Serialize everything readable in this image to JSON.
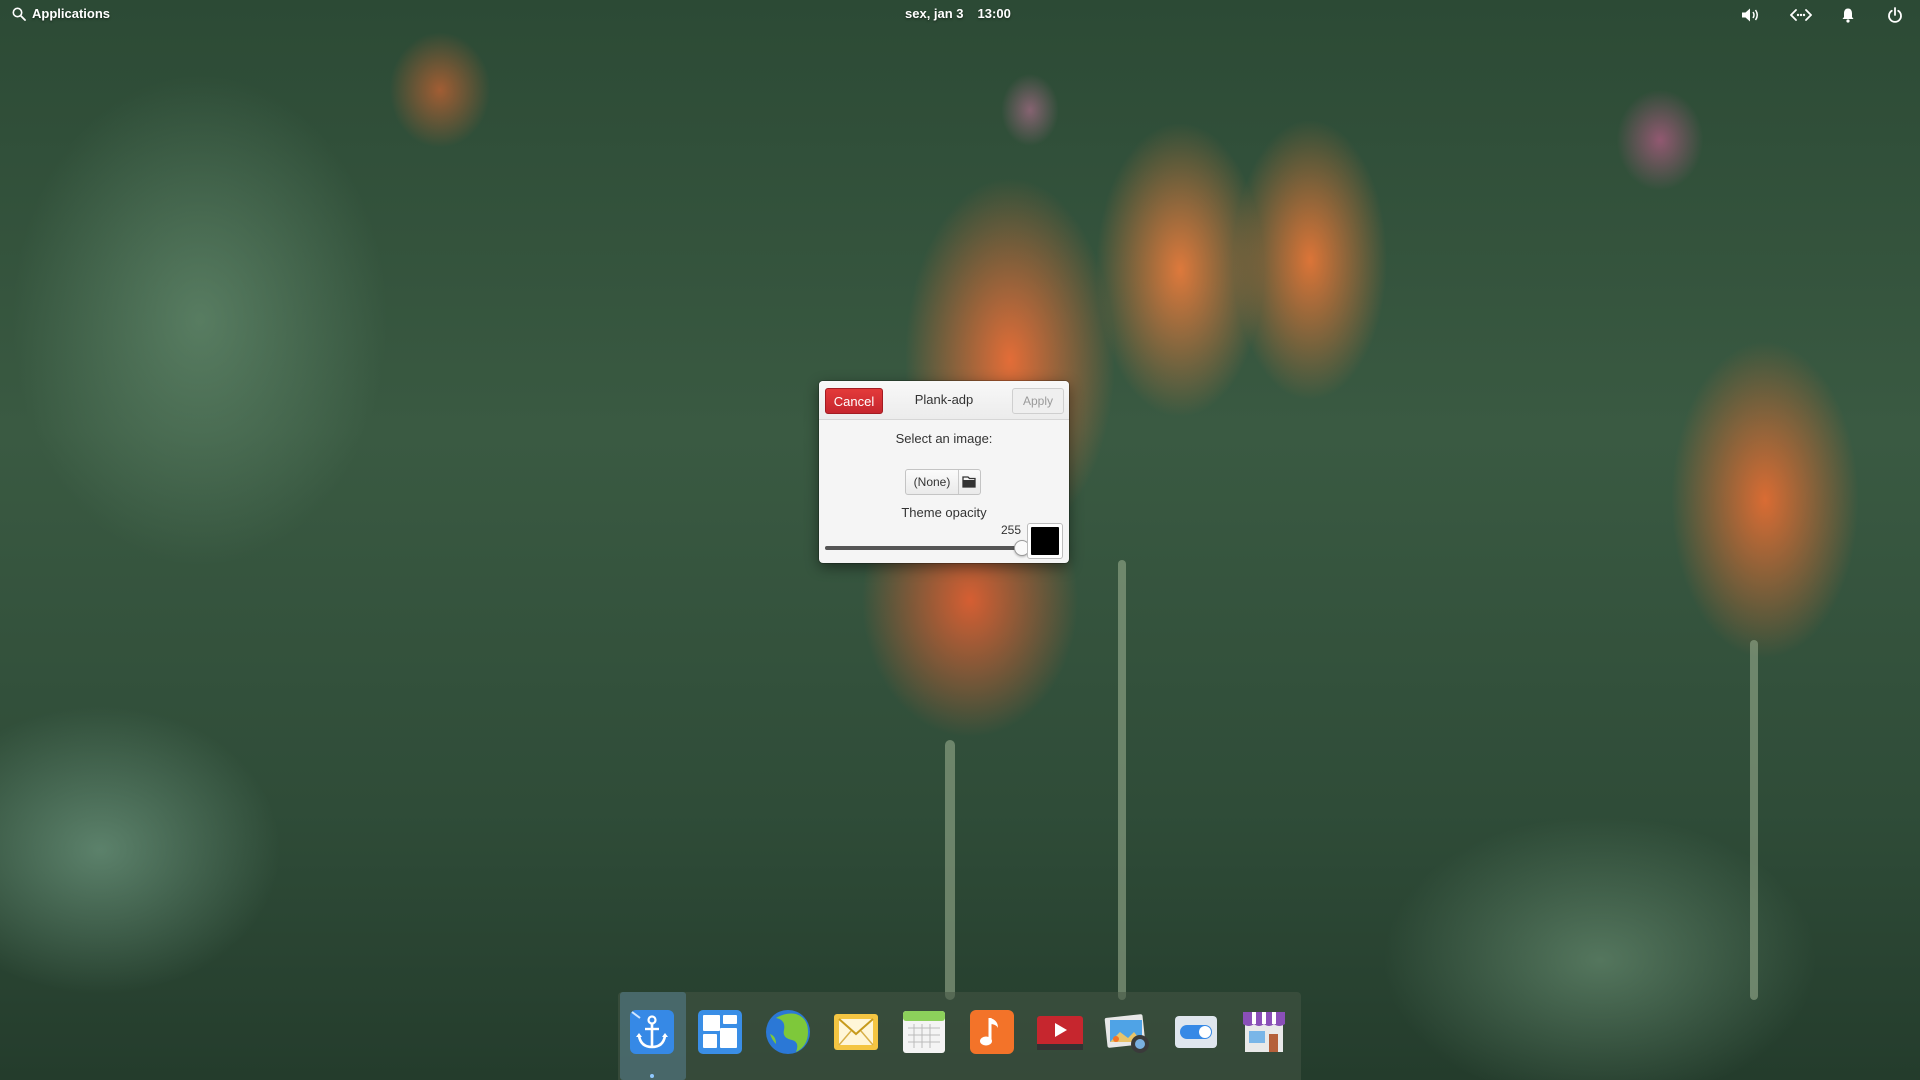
{
  "top_panel": {
    "applications_label": "Applications",
    "date": "sex, jan 3",
    "time": "13:00",
    "indicators": [
      "volume-icon",
      "network-icon",
      "notifications-icon",
      "power-icon"
    ]
  },
  "dialog": {
    "title": "Plank-adp",
    "cancel_label": "Cancel",
    "apply_label": "Apply",
    "select_image_label": "Select an image:",
    "file_chooser_value": "(None)",
    "theme_opacity_label": "Theme opacity",
    "opacity_value": "255",
    "opacity_fraction": 1.0,
    "swatch_color": "#000000"
  },
  "dock": {
    "items": [
      {
        "name": "plank-anchor-icon",
        "active": true
      },
      {
        "name": "multitasking-view-icon",
        "active": false
      },
      {
        "name": "web-browser-icon",
        "active": false
      },
      {
        "name": "mail-icon",
        "active": false
      },
      {
        "name": "calendar-icon",
        "active": false
      },
      {
        "name": "music-icon",
        "active": false
      },
      {
        "name": "videos-icon",
        "active": false
      },
      {
        "name": "photos-icon",
        "active": false
      },
      {
        "name": "system-settings-icon",
        "active": false
      },
      {
        "name": "appcenter-icon",
        "active": false
      }
    ]
  },
  "colors": {
    "cancel_red": "#c6262e",
    "panel_text": "#ffffff",
    "dock_active": "#8fc8ff"
  }
}
